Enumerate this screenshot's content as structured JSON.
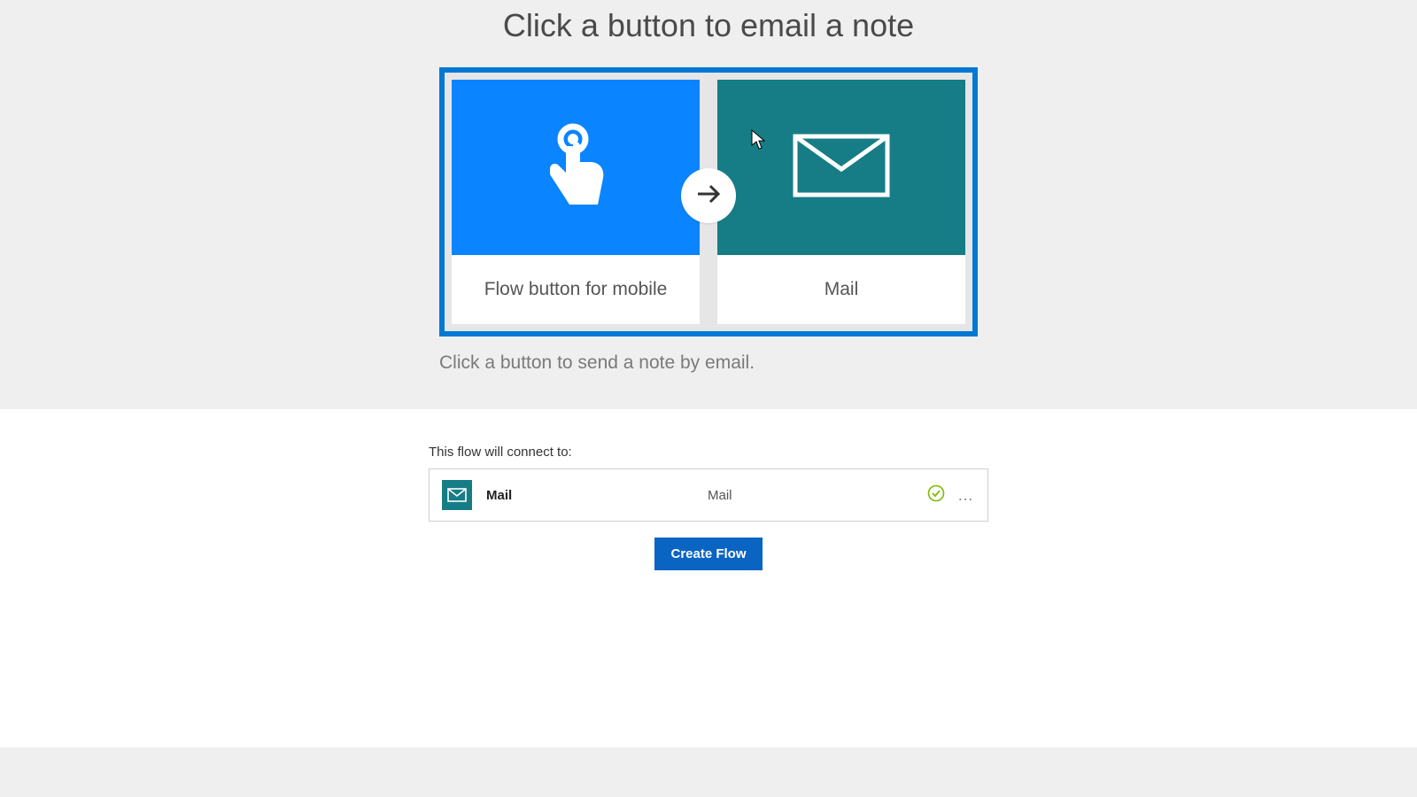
{
  "title": "Click a button to email a note",
  "tiles": {
    "left": {
      "label": "Flow button for mobile"
    },
    "right": {
      "label": "Mail"
    }
  },
  "description": "Click a button to send a note by email.",
  "connect": {
    "heading": "This flow will connect to:",
    "row": {
      "name": "Mail",
      "account": "Mail"
    }
  },
  "create_button": "Create Flow"
}
